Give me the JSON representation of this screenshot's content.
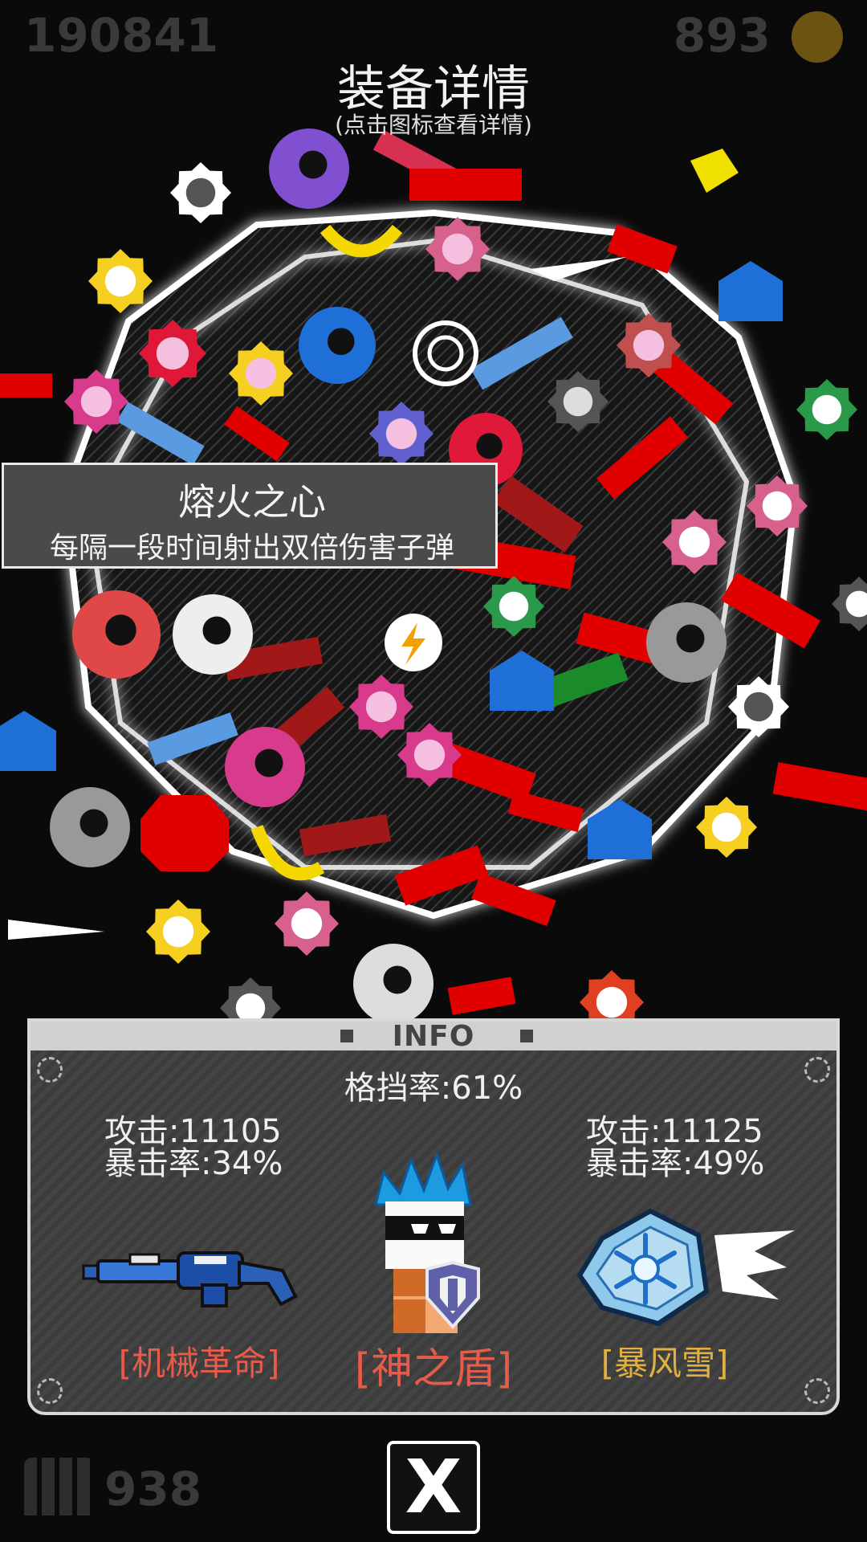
{
  "hud": {
    "score": "190841",
    "coins": "893",
    "ammo": "938"
  },
  "header": {
    "title": "装备详情",
    "subtitle": "(点击图标查看详情)"
  },
  "tooltip": {
    "name": "熔火之心",
    "description": "每隔一段时间射出双倍伤害子弹"
  },
  "info_panel": {
    "title": "INFO",
    "block_rate": "格挡率:61%",
    "left_weapon": {
      "attack": "攻击:11105",
      "crit": "暴击率:34%",
      "name": "[机械革命]",
      "name_color": "#e85a4a"
    },
    "character": {
      "name": "[神之盾]",
      "name_color": "#e85a4a"
    },
    "right_weapon": {
      "attack": "攻击:11125",
      "crit": "暴击率:49%",
      "name": "[暴风雪]",
      "name_color": "#e0b040"
    }
  },
  "buttons": {
    "close_label": "X"
  },
  "icons": [
    "coin-icon",
    "ammo-icon",
    "copyright-icon",
    "lightning-icon",
    "gear-icon",
    "gun-icon",
    "snowflake-icon",
    "shield-icon",
    "close-icon"
  ],
  "colors": {
    "accent_red": "#e00000",
    "accent_yellow": "#f5d800",
    "accent_blue": "#1e6fd8",
    "accent_pink": "#d83a8c"
  }
}
